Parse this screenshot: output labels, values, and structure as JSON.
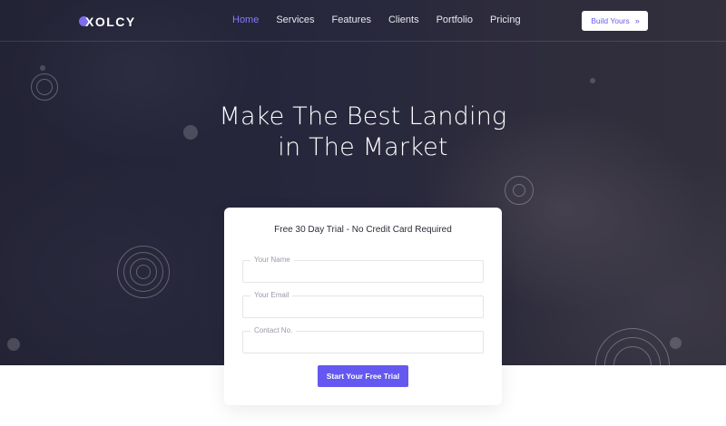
{
  "brand": {
    "logo_text": "XOLCY",
    "accent": "#6458f0"
  },
  "nav": {
    "items": [
      {
        "label": "Home",
        "active": true
      },
      {
        "label": "Services",
        "active": false
      },
      {
        "label": "Features",
        "active": false
      },
      {
        "label": "Clients",
        "active": false
      },
      {
        "label": "Portfolio",
        "active": false
      },
      {
        "label": "Pricing",
        "active": false
      }
    ],
    "cta_label": "Build Yours",
    "cta_icon": "double-chevron-right-icon"
  },
  "hero": {
    "headline_line1": "Make The Best Landing",
    "headline_line2": "in The Market"
  },
  "form": {
    "title": "Free 30 Day Trial - No Credit Card Required",
    "fields": [
      {
        "label": "Your Name",
        "value": ""
      },
      {
        "label": "Your Email",
        "value": ""
      },
      {
        "label": "Contact No.",
        "value": ""
      }
    ],
    "submit_label": "Start Your Free Trial"
  }
}
